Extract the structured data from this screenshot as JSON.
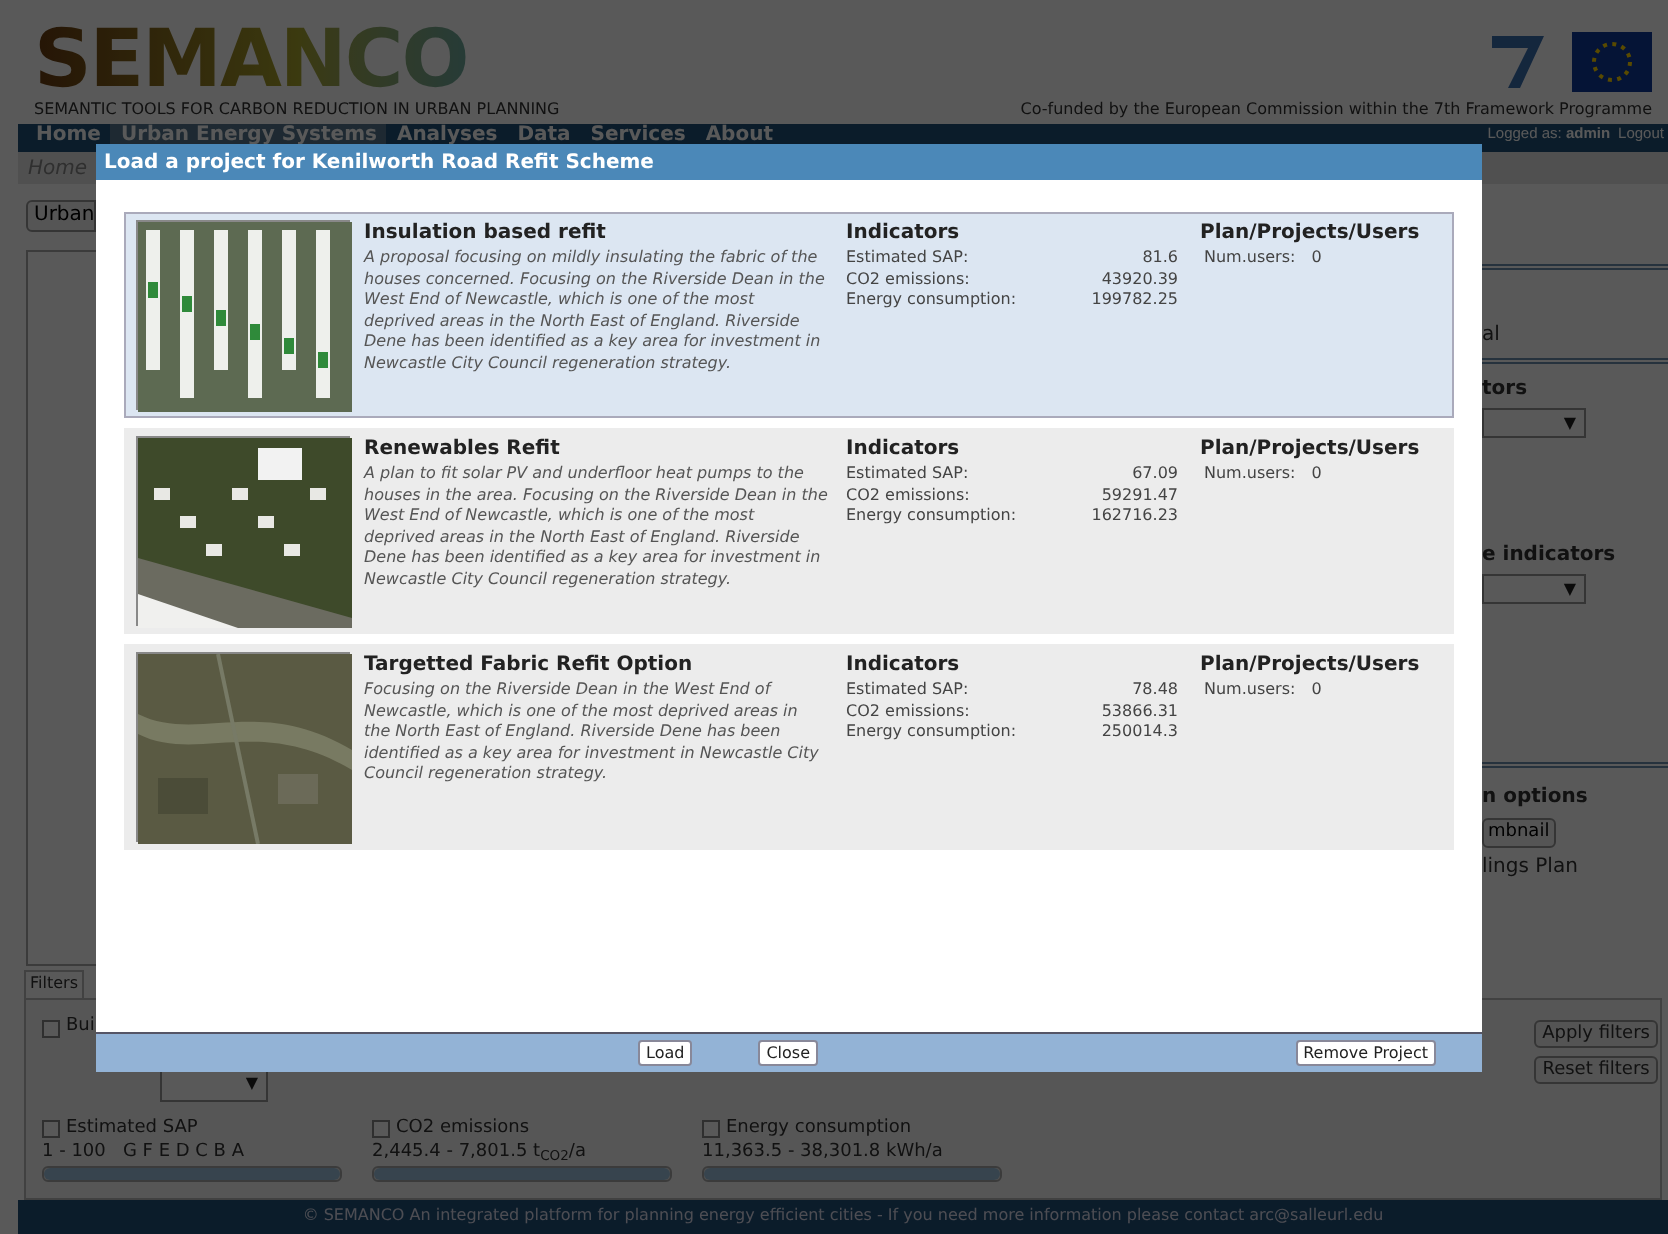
{
  "header": {
    "logo": "SEMANCO",
    "tagline": "SEMANTIC TOOLS FOR CARBON REDUCTION IN URBAN PLANNING",
    "cofunded": "Co-funded by the European Commission within the 7th Framework Programme"
  },
  "nav": {
    "items": [
      {
        "label": "Home",
        "selected": false
      },
      {
        "label": "Urban Energy Systems",
        "selected": true
      },
      {
        "label": "Analyses",
        "selected": false
      },
      {
        "label": "Data",
        "selected": false
      },
      {
        "label": "Services",
        "selected": false
      },
      {
        "label": "About",
        "selected": false
      }
    ],
    "logged": "Logged as: **admin**",
    "logout": "Logout"
  },
  "breadcrumb": "Home",
  "left_panel": {
    "button": "Urban"
  },
  "right_panel": {
    "sections": [
      {
        "items": [
          {
            "kind": "text",
            "text": "al"
          }
        ]
      },
      {
        "items": [
          {
            "kind": "heading",
            "text": "tors"
          },
          {
            "kind": "dropdown",
            "text": "▼"
          },
          {
            "kind": "heading",
            "text": "e indicators"
          },
          {
            "kind": "dropdown",
            "text": "▼"
          }
        ]
      },
      {
        "items": [
          {
            "kind": "heading",
            "text": "n options"
          },
          {
            "kind": "button",
            "text": "mbnail"
          },
          {
            "kind": "text",
            "text": "lings Plan"
          }
        ]
      }
    ]
  },
  "filters": {
    "tabs": [
      {
        "label": "Filters",
        "selected": true
      }
    ],
    "building": {
      "label": "Bui",
      "checked": false
    },
    "dropdown": {
      "arrow": "▼"
    },
    "buttons": [
      "Apply filters",
      "Reset filters"
    ],
    "ranges": [
      {
        "label": "Estimated SAP",
        "checked": false,
        "range": "1 - 100   G F E D C B A",
        "level": 1
      },
      {
        "label": "CO2 emissions",
        "checked": false,
        "range": "2,445.4 - 7,801.5 t$_{CO2}$/a",
        "level": 1
      },
      {
        "label": "Energy consumption",
        "checked": false,
        "range": "11,363.5 - 38,301.8 kWh/a",
        "level": 1
      }
    ]
  },
  "footer": "© SEMANCO An integrated platform for planning energy efficient cities - If you need more information please contact arc@salleurl.edu",
  "dialog": {
    "title": "Load a project for Kenilworth Road Refit Scheme",
    "projects": [
      {
        "name": "Insulation based refit",
        "selected": true,
        "description": "A proposal focusing on mildly insulating the fabric of the houses concerned. Focusing on the Riverside Dean in the West End of Newcastle, which is one of the most deprived areas in the North East of England. Riverside Dene has been identified as a key area for investment in Newcastle City Council regeneration strategy.",
        "indicators_heading": "Indicators",
        "indicators": [
          {
            "label": "Estimated SAP:",
            "value": "81.6"
          },
          {
            "label": "CO2 emissions:",
            "value": "43920.39"
          },
          {
            "label": "Energy consumption:",
            "value": "199782.25"
          }
        ],
        "users_heading": "Plan/Projects/Users",
        "users_label": "Num.users:",
        "users_value": "0"
      },
      {
        "name": "Renewables Refit",
        "selected": false,
        "description": "A plan to fit solar PV and underfloor heat pumps to the houses in the area. Focusing on the Riverside Dean in the West End of Newcastle, which is one of the most deprived areas in the North East of England. Riverside Dene has been identified as a key area for investment in Newcastle City Council regeneration strategy.",
        "indicators_heading": "Indicators",
        "indicators": [
          {
            "label": "Estimated SAP:",
            "value": "67.09"
          },
          {
            "label": "CO2 emissions:",
            "value": "59291.47"
          },
          {
            "label": "Energy consumption:",
            "value": "162716.23"
          }
        ],
        "users_heading": "Plan/Projects/Users",
        "users_label": "Num.users:",
        "users_value": "0"
      },
      {
        "name": "Targetted Fabric Refit Option",
        "selected": false,
        "description": "Focusing on the Riverside Dean in the West End of Newcastle, which is one of the most deprived areas in the North East of England. Riverside Dene has been identified as a key area for investment in Newcastle City Council regeneration strategy.",
        "indicators_heading": "Indicators",
        "indicators": [
          {
            "label": "Estimated SAP:",
            "value": "78.48"
          },
          {
            "label": "CO2 emissions:",
            "value": "53866.31"
          },
          {
            "label": "Energy consumption:",
            "value": "250014.3"
          }
        ],
        "users_heading": "Plan/Projects/Users",
        "users_label": "Num.users:",
        "users_value": "0"
      }
    ],
    "buttons": {
      "center": [
        "Load",
        "Close"
      ],
      "right": [
        "Remove Project"
      ]
    }
  }
}
